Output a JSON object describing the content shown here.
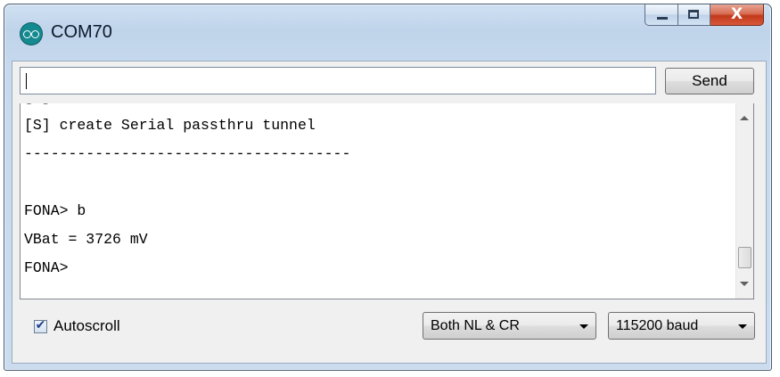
{
  "window": {
    "title": "COM70",
    "app_icon": "arduino-infinity-icon",
    "controls": {
      "minimize_icon": "minimize-icon",
      "maximize_icon": "maximize-icon",
      "close_icon": "close-icon",
      "close_glyph": "X"
    }
  },
  "input": {
    "value": "",
    "placeholder": ""
  },
  "toolbar": {
    "send_label": "Send"
  },
  "serial_output": {
    "lines": [
      "[?]",
      "[S] create Serial passthru tunnel",
      "-------------------------------------",
      "",
      "FONA> b",
      "VBat = 3726 mV",
      "FONA>"
    ]
  },
  "footer": {
    "autoscroll_label": "Autoscroll",
    "autoscroll_checked": true,
    "line_ending": "Both NL & CR",
    "baud_rate": "115200 baud"
  },
  "colors": {
    "close_button": "#c2391b",
    "app_icon": "#14898f",
    "title_bar": "#c6d9ee"
  }
}
